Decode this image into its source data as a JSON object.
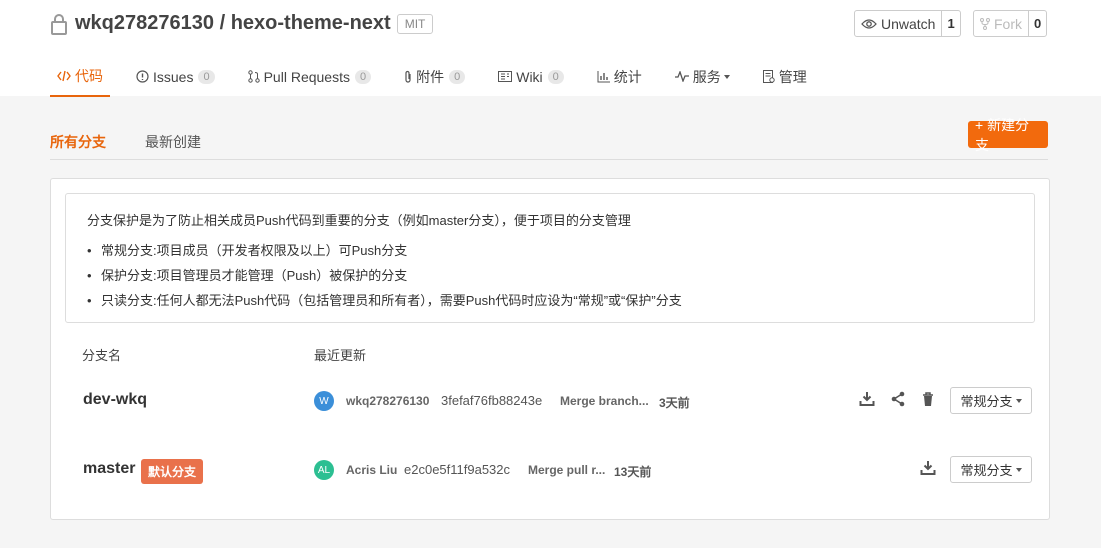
{
  "repo": {
    "owner": "wkq278276130",
    "separator": " / ",
    "name": "hexo-theme-next",
    "license": "MIT"
  },
  "social": {
    "unwatch_label": "Unwatch",
    "unwatch_count": "1",
    "fork_label": "Fork",
    "fork_count": "0"
  },
  "tabs": [
    {
      "label": "代码",
      "icon": "code-icon",
      "active": true
    },
    {
      "label": "Issues",
      "count": "0",
      "icon": "issue-icon"
    },
    {
      "label": "Pull Requests",
      "count": "0",
      "icon": "pull-request-icon"
    },
    {
      "label": "附件",
      "count": "0",
      "icon": "paperclip-icon"
    },
    {
      "label": "Wiki",
      "count": "0",
      "icon": "wiki-icon"
    },
    {
      "label": "统计",
      "icon": "chart-icon"
    },
    {
      "label": "服务",
      "icon": "pulse-icon",
      "dropdown": true
    },
    {
      "label": "管理",
      "icon": "settings-doc-icon"
    }
  ],
  "subnav": {
    "all": "所有分支",
    "recent": "最新创建",
    "new_branch": "+ 新建分支"
  },
  "info": {
    "title": "分支保护是为了防止相关成员Push代码到重要的分支（例如master分支），便于项目的分支管理",
    "items": [
      "常规分支:项目成员（开发者权限及以上）可Push分支",
      "保护分支:项目管理员才能管理（Push）被保护的分支",
      "只读分支:任何人都无法Push代码（包括管理员和所有者），需要Push代码时应设为“常规”或“保护”分支"
    ]
  },
  "columns": {
    "name": "分支名",
    "updated": "最近更新"
  },
  "branches": [
    {
      "name": "dev-wkq",
      "avatar": "W",
      "avatar_color": "#3b8fd9",
      "author": "wkq278276130",
      "sha": "3fefaf76fb88243e",
      "message": "Merge branch...",
      "time": "3天前",
      "type": "常规分支"
    },
    {
      "name": "master",
      "badge": "默认分支",
      "avatar": "AL",
      "avatar_color": "#2cbf92",
      "author": "Acris Liu",
      "sha": "e2c0e5f11f9a532c",
      "message": "Merge pull r...",
      "time": "13天前",
      "type": "常规分支"
    }
  ],
  "colors": {
    "accent": "#e8650c",
    "button": "#f26a0d",
    "badge": "#e9714b"
  }
}
